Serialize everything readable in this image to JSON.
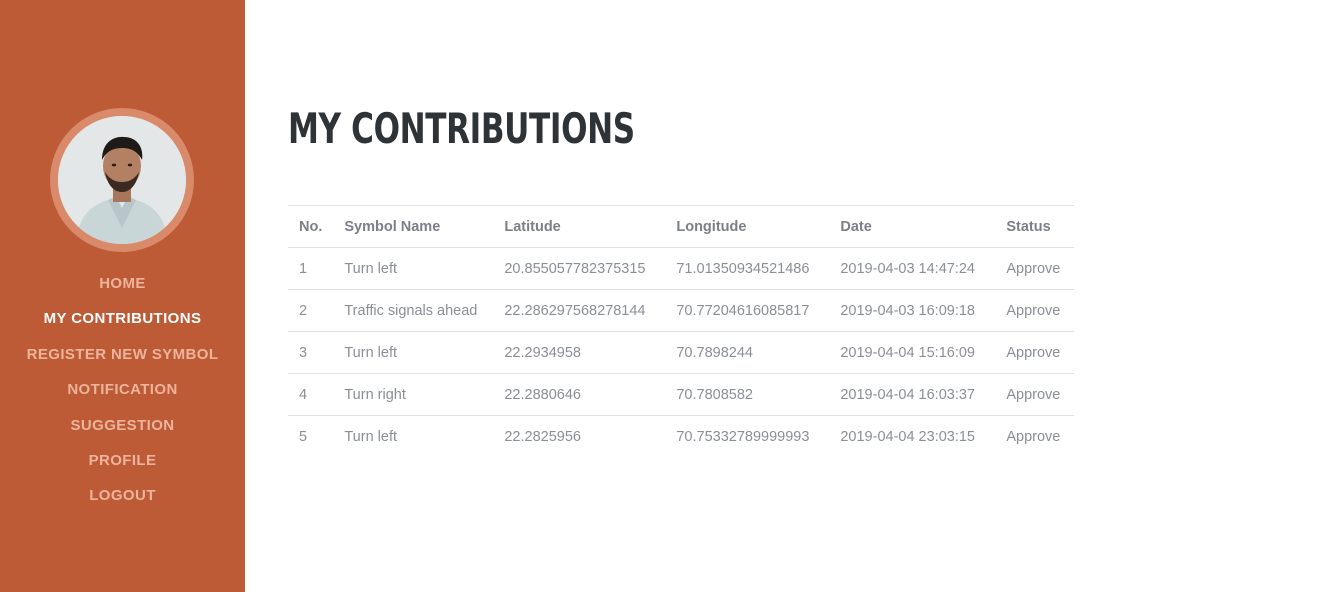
{
  "sidebar": {
    "avatar_label": "user avatar",
    "nav": [
      {
        "label": "HOME",
        "active": false
      },
      {
        "label": "MY CONTRIBUTIONS",
        "active": true
      },
      {
        "label": "REGISTER NEW SYMBOL",
        "active": false
      },
      {
        "label": "NOTIFICATION",
        "active": false
      },
      {
        "label": "SUGGESTION",
        "active": false
      },
      {
        "label": "PROFILE",
        "active": false
      },
      {
        "label": "LOGOUT",
        "active": false
      }
    ]
  },
  "main": {
    "title": "MY CONTRIBUTIONS",
    "table": {
      "headers": [
        "No.",
        "Symbol Name",
        "Latitude",
        "Longitude",
        "Date",
        "Status"
      ],
      "rows": [
        [
          "1",
          "Turn left",
          "20.855057782375315",
          "71.01350934521486",
          "2019-04-03 14:47:24",
          "Approve"
        ],
        [
          "2",
          "Traffic signals ahead",
          "22.286297568278144",
          "70.77204616085817",
          "2019-04-03 16:09:18",
          "Approve"
        ],
        [
          "3",
          "Turn left",
          "22.2934958",
          "70.7898244",
          "2019-04-04 15:16:09",
          "Approve"
        ],
        [
          "4",
          "Turn right",
          "22.2880646",
          "70.7808582",
          "2019-04-04 16:03:37",
          "Approve"
        ],
        [
          "5",
          "Turn left",
          "22.2825956",
          "70.75332789999993",
          "2019-04-04 23:03:15",
          "Approve"
        ]
      ]
    }
  },
  "colors": {
    "sidebar_bg": "#bc5b35",
    "nav_text": "#eeb39c",
    "nav_active_text": "#ffffff",
    "title_text": "#2e3338",
    "table_text": "#8a8f96"
  }
}
